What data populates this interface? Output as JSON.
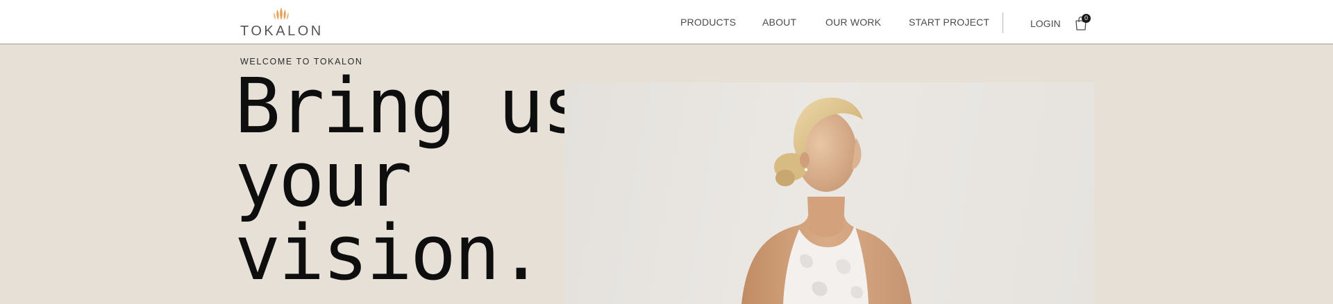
{
  "brand": {
    "name": "TOKALON",
    "mark_icon": "lotus-petals-icon",
    "accent_color": "#e3a25a"
  },
  "nav": {
    "items": [
      {
        "label": "PRODUCTS"
      },
      {
        "label": "ABOUT"
      },
      {
        "label": "OUR WORK"
      },
      {
        "label": "START PROJECT"
      }
    ],
    "login_label": "LOGIN",
    "cart_icon": "shopping-bag-icon",
    "cart_count": "0"
  },
  "hero": {
    "eyebrow": "WELCOME TO TOKALON",
    "headline_lines": [
      "Bring us",
      "your",
      "vision."
    ],
    "image_subject": "woman-in-white-tank-top-photo",
    "background_color": "#e6e0d7"
  }
}
